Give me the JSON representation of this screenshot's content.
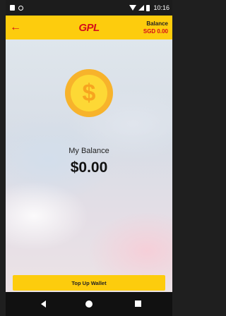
{
  "status_bar": {
    "time": "10:16"
  },
  "app_bar": {
    "back_icon": "←",
    "logo": "GPL",
    "balance_title": "Balance",
    "balance_amount": "SGD 0.00"
  },
  "main": {
    "coin_symbol": "$",
    "label": "My Balance",
    "amount": "$0.00"
  },
  "actions": {
    "top_up_label": "Top Up Wallet"
  },
  "colors": {
    "brand_yellow": "#fdcc0d",
    "brand_red": "#d50f1a",
    "coin_gold": "#f7b32b"
  }
}
